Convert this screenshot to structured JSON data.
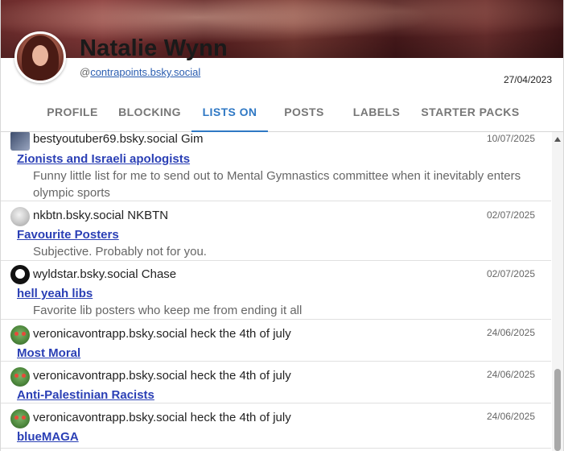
{
  "profile": {
    "display_name": "Natalie Wynn",
    "handle_prefix": "@",
    "handle": "contrapoints.bsky.social",
    "joined_date": "27/04/2023"
  },
  "tabs": [
    {
      "label": "PROFILE",
      "active": false
    },
    {
      "label": "BLOCKING",
      "active": false
    },
    {
      "label": "LISTS ON",
      "active": true
    },
    {
      "label": "POSTS",
      "active": false
    },
    {
      "label": "LABELS",
      "active": false
    },
    {
      "label": "STARTER PACKS",
      "active": false
    }
  ],
  "lists": [
    {
      "owner": "bestyoutuber69.bsky.social Gim",
      "date": "10/07/2025",
      "title": "Zionists and Israeli apologists",
      "description": "Funny little list for me to send out to Mental Gymnastics committee when it inevitably enters olympic sports",
      "avatar_icon": "user-avatar-icon"
    },
    {
      "owner": "nkbtn.bsky.social NKBTN",
      "date": "02/07/2025",
      "title": "Favourite Posters",
      "description": "Subjective. Probably not for you.",
      "avatar_icon": "user-avatar-icon"
    },
    {
      "owner": "wyldstar.bsky.social Chase",
      "date": "02/07/2025",
      "title": "hell yeah libs",
      "description": "Favorite lib posters who keep me from ending it all",
      "avatar_icon": "user-avatar-icon"
    },
    {
      "owner": "veronicavontrapp.bsky.social heck the 4th of july",
      "date": "24/06/2025",
      "title": "Most Moral",
      "description": "",
      "avatar_icon": "user-avatar-icon"
    },
    {
      "owner": "veronicavontrapp.bsky.social heck the 4th of july",
      "date": "24/06/2025",
      "title": "Anti-Palestinian Racists",
      "description": "",
      "avatar_icon": "user-avatar-icon"
    },
    {
      "owner": "veronicavontrapp.bsky.social heck the 4th of july",
      "date": "24/06/2025",
      "title": "blueMAGA",
      "description": "",
      "avatar_icon": "user-avatar-icon"
    }
  ],
  "colors": {
    "accent": "#2f78c4",
    "link": "#2a3fb5"
  }
}
